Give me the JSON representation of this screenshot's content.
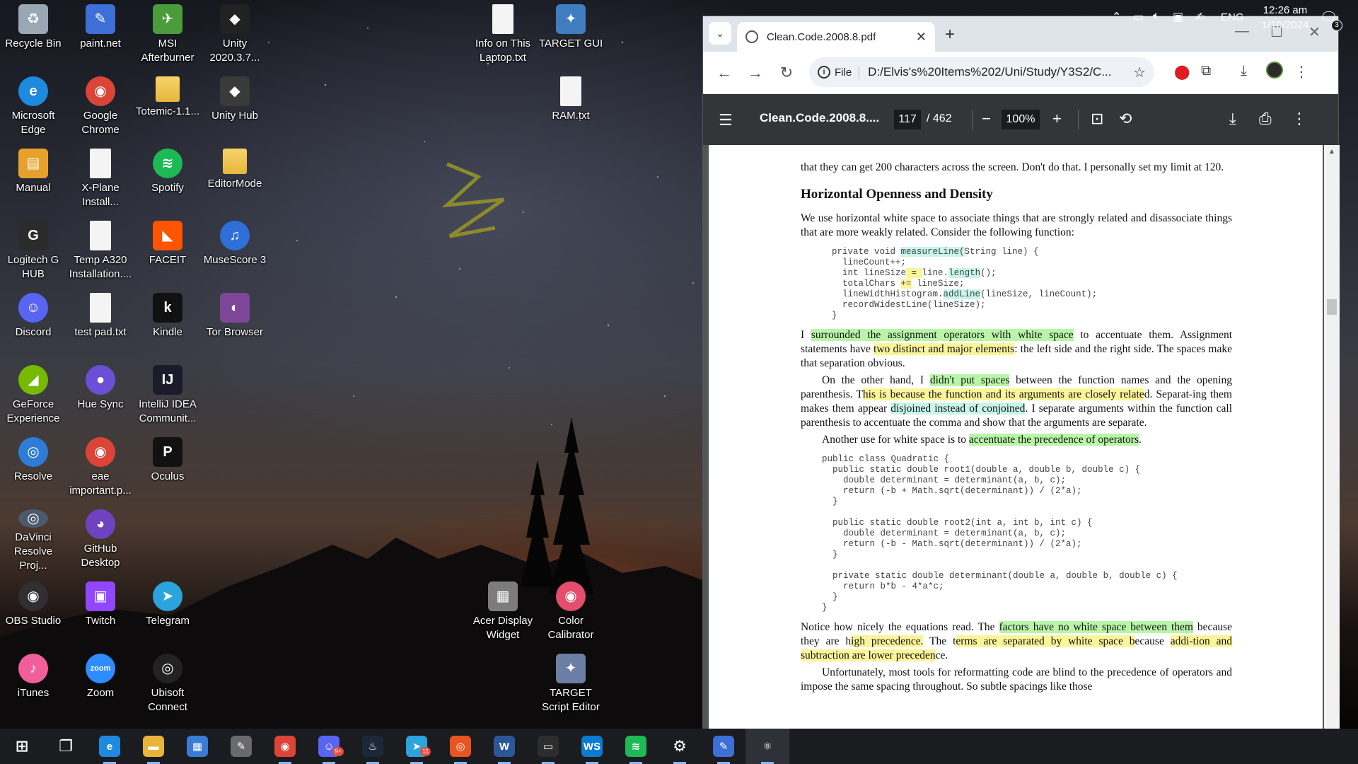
{
  "desktop": {
    "icons": [
      {
        "label": "Recycle Bin",
        "glyph": "♻",
        "color": "#9aa7b5"
      },
      {
        "label": "paint.net",
        "glyph": "✎",
        "color": "#3d6fd6"
      },
      {
        "label": "MSI Afterburner",
        "glyph": "✈",
        "color": "#4a9b3a"
      },
      {
        "label": "Unity 2020.3.7...",
        "glyph": "◆",
        "color": "#222222"
      },
      {
        "label": "Microsoft Edge",
        "glyph": "e",
        "color": "#1d8ae0"
      },
      {
        "label": "Google Chrome",
        "glyph": "◉",
        "color": "#db4437"
      },
      {
        "label": "Totemic-1.1...",
        "glyph": "▤",
        "color": "#f3d26b"
      },
      {
        "label": "Unity Hub",
        "glyph": "◆",
        "color": "#3a3a3a"
      },
      {
        "label": "Manual",
        "glyph": "▤",
        "color": "#e6a02c"
      },
      {
        "label": "X-Plane Install...",
        "glyph": "▯",
        "color": "#f4f4f4"
      },
      {
        "label": "Spotify",
        "glyph": "≋",
        "color": "#1db954"
      },
      {
        "label": "EditorMode",
        "glyph": "▤",
        "color": "#f3d26b"
      },
      {
        "label": "Logitech G HUB",
        "glyph": "G",
        "color": "#2b2b2b"
      },
      {
        "label": "Temp A320 Installation....",
        "glyph": "▯",
        "color": "#f4f4f4"
      },
      {
        "label": "FACEIT",
        "glyph": "◣",
        "color": "#ff5500"
      },
      {
        "label": "MuseScore 3",
        "glyph": "♫",
        "color": "#2e6fd8"
      },
      {
        "label": "Discord",
        "glyph": "☺",
        "color": "#5865f2"
      },
      {
        "label": "test pad.txt",
        "glyph": "▯",
        "color": "#f4f4f4"
      },
      {
        "label": "Kindle",
        "glyph": "k",
        "color": "#111111"
      },
      {
        "label": "Tor Browser",
        "glyph": "◐",
        "color": "#7d4698"
      },
      {
        "label": "GeForce Experience",
        "glyph": "◢",
        "color": "#76b900"
      },
      {
        "label": "Hue Sync",
        "glyph": "●",
        "color": "#6b4fd6"
      },
      {
        "label": "IntelliJ IDEA Communit...",
        "glyph": "IJ",
        "color": "#1b1b2b"
      },
      {
        "label": "Resolve",
        "glyph": "◎",
        "color": "#2d7cd6"
      },
      {
        "label": "eae important.p...",
        "glyph": "◉",
        "color": "#db4437"
      },
      {
        "label": "Oculus",
        "glyph": "P",
        "color": "#111111"
      },
      {
        "label": "DaVinci Resolve Proj...",
        "glyph": "◎",
        "color": "#4d5a6b"
      },
      {
        "label": "GitHub Desktop",
        "glyph": "◕",
        "color": "#6f42c1"
      },
      {
        "label": "Info on This Laptop.txt",
        "glyph": "▯",
        "color": "#f4f4f4"
      },
      {
        "label": "TARGET GUI",
        "glyph": "✦",
        "color": "#3f7cc0"
      },
      {
        "label": "RAM.txt",
        "glyph": "▯",
        "color": "#f4f4f4"
      },
      {
        "label": "OBS Studio",
        "glyph": "◉",
        "color": "#302e31"
      },
      {
        "label": "Twitch",
        "glyph": "▣",
        "color": "#9146ff"
      },
      {
        "label": "Telegram",
        "glyph": "➤",
        "color": "#2aa3df"
      },
      {
        "label": "Acer Display Widget",
        "glyph": "▦",
        "color": "#7c7c7c"
      },
      {
        "label": "Color Calibrator",
        "glyph": "◉",
        "color": "#e44d6b"
      },
      {
        "label": "iTunes",
        "glyph": "♪",
        "color": "#f25d9b"
      },
      {
        "label": "Zoom",
        "glyph": "zoom",
        "color": "#2d8cff"
      },
      {
        "label": "Ubisoft Connect",
        "glyph": "◎",
        "color": "#222222"
      },
      {
        "label": "TARGET Script Editor",
        "glyph": "✦",
        "color": "#6b7fa5"
      }
    ]
  },
  "browser": {
    "tab_title": "Clean.Code.2008.8.pdf",
    "omnibox": {
      "scheme": "File",
      "url": "D:/Elvis's%20Items%202/Uni/Study/Y3S2/C..."
    },
    "pdf_toolbar": {
      "doc_title": "Clean.Code.2008.8....",
      "page_current": "117",
      "page_total": "/ 462",
      "zoom": "100%"
    },
    "page": {
      "p0": "that they can get 200 characters across the screen. Don't do that. I personally set my limit at 120.",
      "heading": "Horizontal Openness and Density",
      "p1": "We use horizontal white space to associate things that are strongly related and disassociate things that are more weakly related. Consider the following function:",
      "code1": [
        {
          "a": "private void ",
          "h": "measureLine(",
          "b": "String line) {",
          "c": "hc"
        },
        {
          "a": "  lineCount++;",
          "h": "",
          "b": "",
          "c": ""
        },
        {
          "a": "  int lineSize",
          "h": " = ",
          "b": "line.",
          "c": "hy"
        },
        {
          "a": "",
          "h": "",
          "b": "",
          "c": ""
        },
        {
          "a": "  totalChars ",
          "h": "+=",
          "b": " lineSize;",
          "c": "hy"
        },
        {
          "a": "  lineWidthHistogram.",
          "h": "addLine",
          "b": "(lineSize, lineCount);",
          "c": "hc"
        },
        {
          "a": "  recordWidestLine(lineSize);",
          "h": "",
          "b": "",
          "c": ""
        },
        {
          "a": "}",
          "h": "",
          "b": "",
          "c": ""
        }
      ],
      "code1_length": "length",
      "code1_tail": "();",
      "p2": {
        "s1": "I ",
        "h1": "surrounded the assignment operators with white space",
        "s2": " to accentuate them. Assignment statements have ",
        "h2": "two distinct and major elements",
        "s3": ": the left side and the right side. The spaces make that separation obvious."
      },
      "p3": {
        "s1": "On the other hand, I ",
        "h1": "didn't put spaces",
        "s2": " between the function names and the opening parenthesis. T",
        "h2": "his is because the function and its arguments are closely relate",
        "s3": "d. Separat-ing them makes them appear ",
        "h3": "disjoined instead of conjoined",
        "s4": ". I separate arguments within the function call parenthesis to accentuate the comma and show that the arguments are separate."
      },
      "p4": {
        "s1": "Another use for white space is to ",
        "h1": "accentuate the precedence of operators",
        "s2": "."
      },
      "code2": "public class Quadratic {\n  public static double root1(double a, double b, double c) {\n    double determinant = determinant(a, b, c);\n    return (-b + Math.sqrt(determinant)) / (2*a);\n  }\n\n  public static double root2(int a, int b, int c) {\n    double determinant = determinant(a, b, c);\n    return (-b - Math.sqrt(determinant)) / (2*a);\n  }\n\n  private static double determinant(double a, double b, double c) {\n    return b*b - 4*a*c;\n  }\n}",
      "p5": {
        "s1": "Notice how nicely the equations read. The ",
        "h1": "factors have no white space between them",
        "s2": " because they are h",
        "h2": "igh precedence.",
        "s3": " The t",
        "h3": "erms are separated by white space b",
        "s4": "ecause ",
        "h4": "addi-tion and subtraction are lower preceden",
        "s5": "ce."
      },
      "p6": "Unfortunately, most tools for reformatting code are blind to the precedence of operators and impose the same spacing throughout. So subtle spacings like those"
    }
  },
  "taskbar": {
    "apps": [
      {
        "name": "windows-start",
        "glyph": "⊞",
        "color": "#1b1c20"
      },
      {
        "name": "task-view",
        "glyph": "❐",
        "color": "#1b1c20"
      },
      {
        "name": "edge",
        "glyph": "e",
        "color": "#1d8ae0"
      },
      {
        "name": "file-explorer",
        "glyph": "▬",
        "color": "#e8b53a"
      },
      {
        "name": "microsoft-store",
        "glyph": "▦",
        "color": "#3a7bd5"
      },
      {
        "name": "paint-brush",
        "glyph": "✎",
        "color": "#6a6a6a"
      },
      {
        "name": "chrome",
        "glyph": "◉",
        "color": "#db4437"
      },
      {
        "name": "discord",
        "glyph": "☺",
        "color": "#5865f2"
      },
      {
        "name": "steam",
        "glyph": "♨",
        "color": "#1b2838"
      },
      {
        "name": "telegram",
        "glyph": "➤",
        "color": "#2aa3df"
      },
      {
        "name": "ubuntu",
        "glyph": "◎",
        "color": "#e95420"
      },
      {
        "name": "word",
        "glyph": "W",
        "color": "#2b579a"
      },
      {
        "name": "terminal",
        "glyph": "▭",
        "color": "#2d2d2d"
      },
      {
        "name": "webstorm",
        "glyph": "WS",
        "color": "#0b7ad1"
      },
      {
        "name": "spotify",
        "glyph": "≋",
        "color": "#1db954"
      },
      {
        "name": "settings",
        "glyph": "⚙",
        "color": "#1b1c20"
      },
      {
        "name": "paint-net",
        "glyph": "✎",
        "color": "#3d6fd6"
      },
      {
        "name": "electron-app",
        "glyph": "⚛",
        "color": "#2f3138"
      }
    ],
    "badges": {
      "discord": "9+",
      "telegram": "11"
    },
    "tray": {
      "language": "ENG",
      "time": "12:26 am",
      "date": "1/10/2024",
      "notification_count": "3"
    }
  },
  "colors": {
    "highlight_green": "#b9f5a8",
    "highlight_yellow": "#fbf59a",
    "highlight_cyan": "#c7f5ea",
    "pdf_toolbar": "#323639"
  }
}
